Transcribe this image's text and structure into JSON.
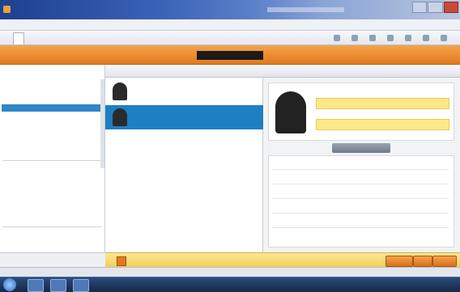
{
  "window": {
    "title": ""
  },
  "menubar": {
    "items": [
      "",
      "",
      ""
    ]
  },
  "toolbar": {
    "active_tab": "",
    "second_tab": ""
  },
  "app": {
    "logo": "",
    "center_label": "",
    "right_links": ""
  },
  "leftnav": {
    "items": []
  },
  "list": {
    "headers": [
      "",
      "",
      ""
    ],
    "contacts": [
      {
        "name": "",
        "sub": ""
      },
      {
        "name": "",
        "sub": ""
      }
    ]
  },
  "detail": {
    "field_labels": [
      "",
      "",
      ""
    ],
    "field_values": [
      "",
      ""
    ],
    "button_label": "",
    "form_labels": []
  },
  "notice": {
    "text": ""
  },
  "leftfoot": {
    "text": ""
  },
  "statusbar": {
    "left": "",
    "right": ""
  },
  "taskbar": {
    "clock": ""
  },
  "colors": {
    "accent_orange": "#e07a1f",
    "selection_blue": "#1e7fc2",
    "highlight_yellow": "#fde98a"
  }
}
